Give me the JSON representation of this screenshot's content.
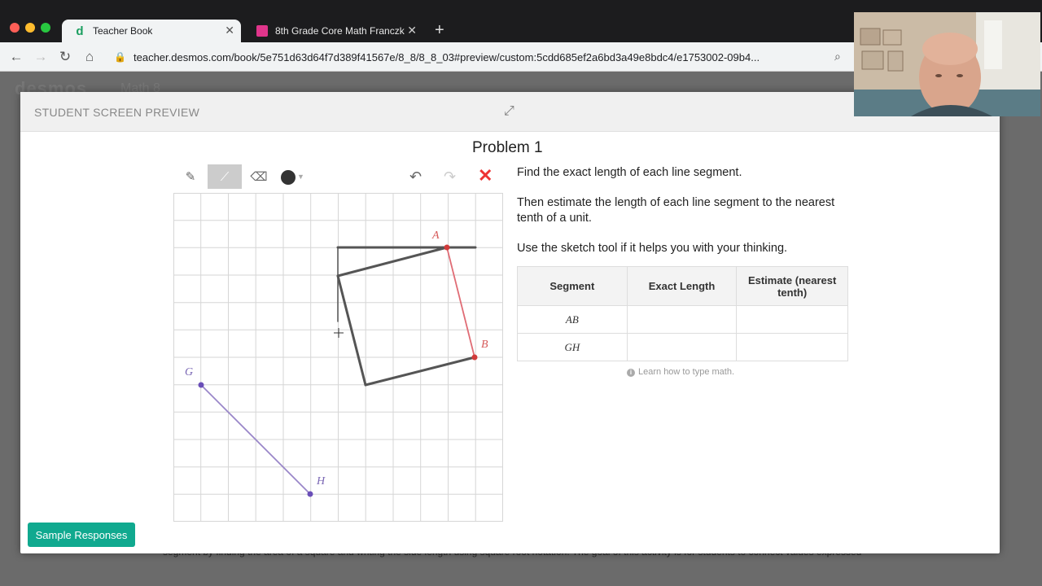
{
  "browser": {
    "tabs": [
      {
        "label": "Teacher Book",
        "icon": "desmos-icon",
        "active": true
      },
      {
        "label": "8th Grade Core Math Franczk",
        "icon": "sheets-icon",
        "active": false
      }
    ],
    "url": "teacher.desmos.com/book/5e751d63d64f7d389f41567e/8_8/8_8_03#preview/custom:5cdd685ef2a6bd3a49e8bdc4/e1753002-09b4..."
  },
  "background": {
    "brand": "desmos",
    "crumb": "Math 8",
    "bottom_text": "segment by finding the area of a square and writing the side length using square root notation. The goal of this activity is for students to connect values expressed"
  },
  "modal": {
    "title": "STUDENT SCREEN PREVIEW",
    "problem_title": "Problem 1",
    "instructions": [
      "Find the exact length of each line segment.",
      "Then estimate the length of each line segment to the nearest tenth of a unit.",
      "Use the sketch tool if it helps you with your thinking."
    ],
    "table": {
      "headers": [
        "Segment",
        "Exact Length",
        "Estimate (nearest tenth)"
      ],
      "rows": [
        {
          "segment": "AB",
          "exact": "",
          "estimate": ""
        },
        {
          "segment": "GH",
          "exact": "",
          "estimate": ""
        }
      ]
    },
    "learn_link": "Learn how to type math.",
    "sample_button": "Sample Responses",
    "points": {
      "A": "A",
      "B": "B",
      "G": "G",
      "H": "H"
    }
  },
  "colors": {
    "accent": "#10a98f",
    "segment_ab": "#e06c75",
    "segment_gh": "#9a87c9",
    "sketch_ink": "#555555",
    "close": "#ee3333"
  }
}
